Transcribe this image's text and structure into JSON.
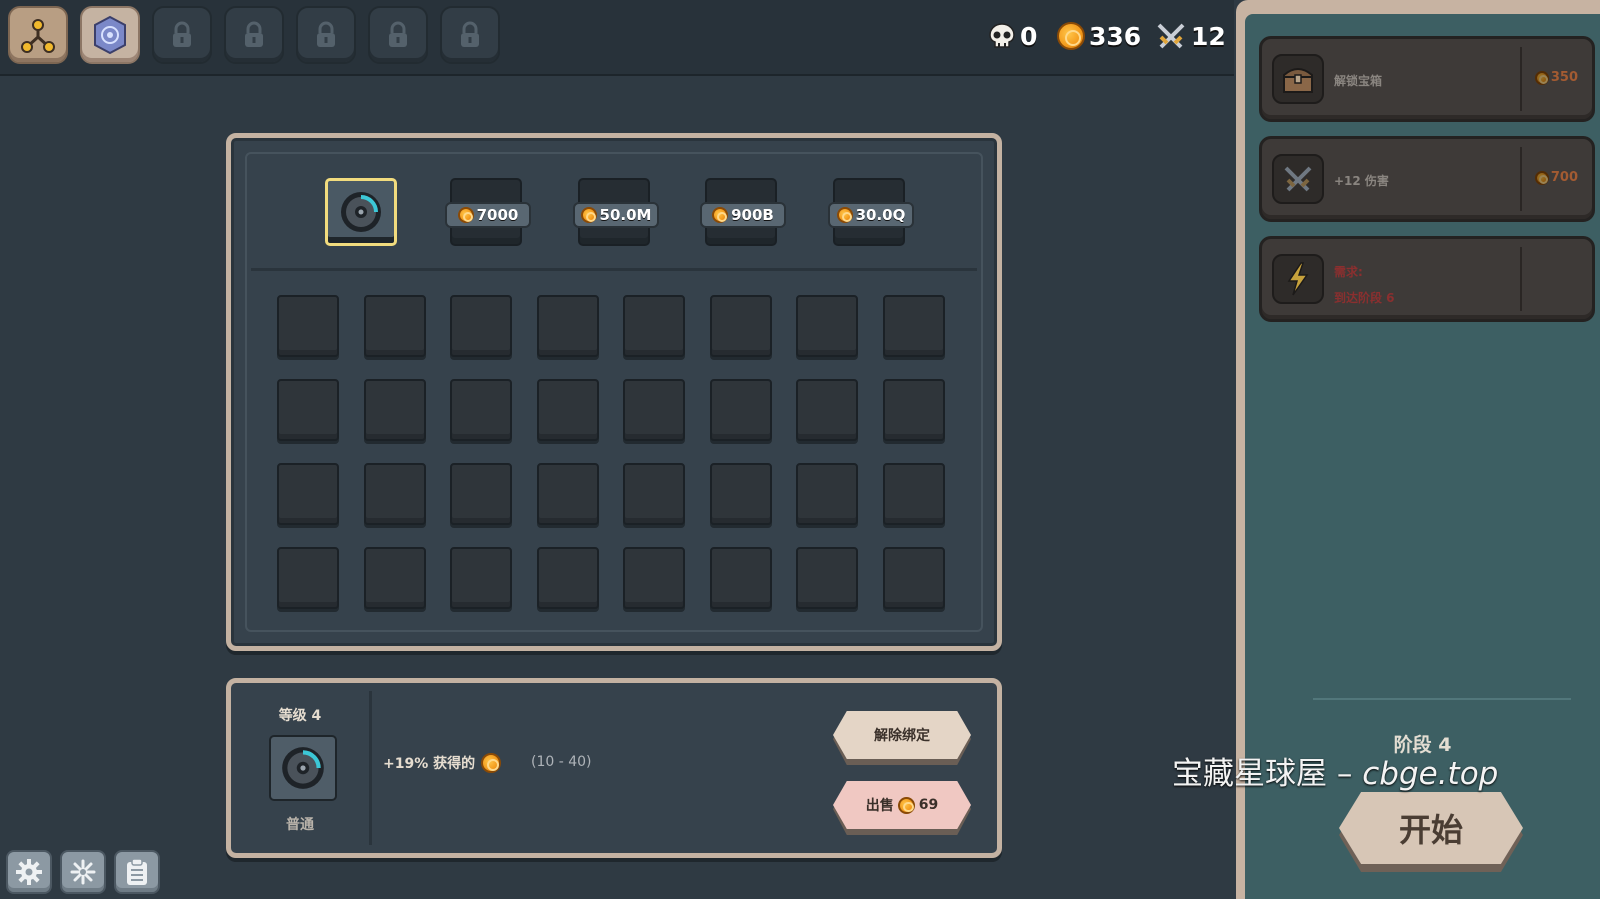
{
  "top_bar": {
    "tabs": [
      {
        "name": "skill-tree-tab",
        "icon": "nodes-icon",
        "locked": false
      },
      {
        "name": "rune-tab",
        "icon": "rune-stone-icon",
        "locked": false
      },
      {
        "name": "locked-tab-3",
        "icon": "lock-icon",
        "locked": true
      },
      {
        "name": "locked-tab-4",
        "icon": "lock-icon",
        "locked": true
      },
      {
        "name": "locked-tab-5",
        "icon": "lock-icon",
        "locked": true
      },
      {
        "name": "locked-tab-6",
        "icon": "lock-icon",
        "locked": true
      },
      {
        "name": "locked-tab-7",
        "icon": "lock-icon",
        "locked": true
      }
    ],
    "stats": {
      "skulls": "0",
      "coins": "336",
      "damage": "12"
    }
  },
  "inventory": {
    "pages": [
      {
        "selected": true,
        "price": ""
      },
      {
        "selected": false,
        "price": "7000"
      },
      {
        "selected": false,
        "price": "50.0M"
      },
      {
        "selected": false,
        "price": "900B"
      },
      {
        "selected": false,
        "price": "30.0Q"
      }
    ],
    "rows": 4,
    "cols": 8
  },
  "item_details": {
    "level": "等级 4",
    "rarity": "普通",
    "effect": "+19% 获得的",
    "range": "(10 - 40)",
    "unbind_label": "解除绑定",
    "sell_label": "出售",
    "sell_price": "69"
  },
  "bottom_icons": [
    "gear-icon",
    "sparkle-icon",
    "clipboard-icon"
  ],
  "sidebar": {
    "upgrades": [
      {
        "icon": "chest-icon",
        "label": "解锁宝箱",
        "cost": "350"
      },
      {
        "icon": "sword-icon",
        "label": "+12 伤害",
        "cost": "700"
      },
      {
        "icon": "lightning-icon",
        "req_line1": "需求:",
        "req_line2": "到达阶段 6"
      }
    ],
    "stage_label": "阶段 4",
    "start_label": "开始"
  },
  "watermark": {
    "text_cn": "宝藏星球屋 – ",
    "text_url": "cbge.top"
  },
  "colors": {
    "background": "#2f3a43",
    "panel_border": "#c4b2a2",
    "sidebar_bg": "#3d5f63",
    "coin": "#f39a1c",
    "selected_border": "#f2dc7e"
  }
}
